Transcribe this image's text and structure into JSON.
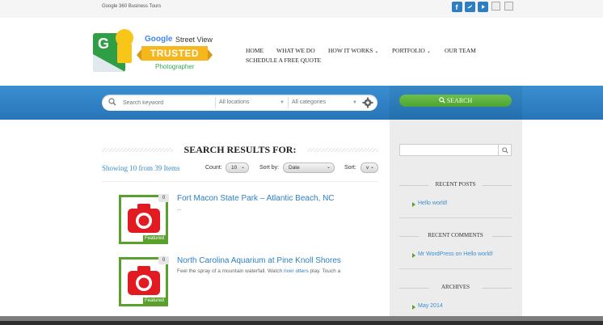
{
  "topbar": {
    "tagline": "Google 360 Business Tours"
  },
  "logo": {
    "g_letter": "G",
    "google": "Google",
    "street_view": "Street View",
    "trusted": "TRUSTED",
    "photographer": "Photographer"
  },
  "nav": {
    "items": [
      {
        "label": "Home"
      },
      {
        "label": "What We Do"
      },
      {
        "label": "How It Works"
      },
      {
        "label": "Portfolio"
      },
      {
        "label": "Our Team"
      },
      {
        "label": "Schedule A Free Quote"
      }
    ]
  },
  "search": {
    "placeholder": "Search keyword",
    "location": "All locations",
    "category": "All categories",
    "button_label": "SEARCH"
  },
  "results": {
    "title": "SEARCH RESULTS FOR:",
    "showing": "Showing 10 from 39 Items",
    "count_label": "Count:",
    "count_value": "10",
    "sortby_label": "Sort by:",
    "sortby_value": "Date",
    "sort_label": "Sort:",
    "sort_value": "v"
  },
  "items": [
    {
      "title": "Fort Macon State Park – Atlantic Beach, NC",
      "excerpt": "...",
      "count": "0",
      "badge": "Featured"
    },
    {
      "title": "North Carolina Aquarium at Pine Knoll Shores",
      "excerpt_pre": "Feel the spray of a mountain waterfall. Watch ",
      "excerpt_link": "river otters",
      "excerpt_post": " play. Touch a",
      "count": "0",
      "badge": "Featured"
    }
  ],
  "sidebar": {
    "recent_posts_title": "RECENT POSTS",
    "recent_posts": [
      "Hello world!"
    ],
    "recent_comments_title": "RECENT COMMENTS",
    "recent_comments": [
      "Mr WordPress on Hello world!"
    ],
    "archives_title": "ARCHIVES",
    "archives": [
      "May 2014"
    ]
  },
  "colors": {
    "accent_blue": "#2d7fc1",
    "accent_green": "#5aa02c",
    "band_blue": "#3a8fd0"
  }
}
